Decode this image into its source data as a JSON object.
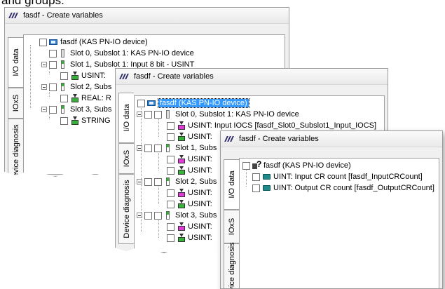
{
  "caption": "and groups:",
  "windows": [
    {
      "title": "fasdf - Create variables",
      "tabs": [
        "I/O data",
        "IOxS",
        "Device diagnosis"
      ],
      "rows": [
        "fasdf (KAS PN-IO device)",
        "Slot 0, Subslot 1: KAS PN-IO device",
        "Slot 1, Subslot 1: Input  8 bit - USINT",
        "USINT:",
        "Slot 2, Subs",
        "REAL: R",
        "Slot 3, Subs",
        "STRING"
      ]
    },
    {
      "title": "fasdf - Create variables",
      "tabs": [
        "I/O data",
        "IOxS",
        "Device diagnosis"
      ],
      "rows": [
        "fasdf (KAS PN-IO device)",
        "Slot 0, Subslot 1: KAS PN-IO device",
        "USINT: Input IOCS [fasdf_Slot0_Subslot1_Input_IOCS]",
        "USINT:",
        "Slot 1, Subs",
        "USINT:",
        "USINT:",
        "Slot 2, Subs",
        "USINT:",
        "USINT:",
        "Slot 3, Subs",
        "USINT:",
        "USINT:"
      ]
    },
    {
      "title": "fasdf - Create variables",
      "tabs": [
        "I/O data",
        "IOxS",
        "Device diagnosis"
      ],
      "rows": [
        "fasdf (KAS PN-IO device)",
        "UINT: Input CR count [fasdf_InputCRCount]",
        "UINT: Output CR count [fasdf_OutputCRCount]"
      ]
    }
  ]
}
